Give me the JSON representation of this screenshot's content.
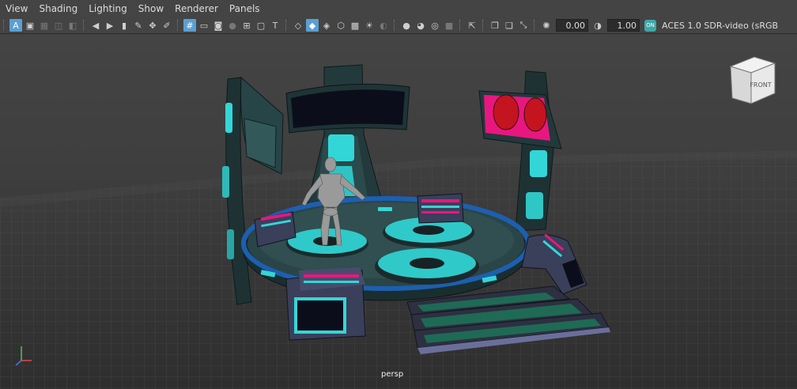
{
  "menu": [
    "View",
    "Shading",
    "Lighting",
    "Show",
    "Renderer",
    "Panels"
  ],
  "toolbar": {
    "exposure": "0.00",
    "gamma": "1.00",
    "cm_badge": "ON",
    "color_space": "ACES 1.0 SDR-video (sRGB"
  },
  "viewcube": {
    "face": "FRONT"
  },
  "camera": "persp",
  "icons": [
    "select-camera-icon",
    "lock-camera-icon",
    "bookmark-icon",
    "image-plane-icon",
    "grid-icon",
    "wireframe-icon",
    "smooth-shade-icon",
    "textured-icon",
    "lights-icon",
    "shadows-icon",
    "xray-icon",
    "isolate-icon",
    "exposure-icon",
    "color-management-icon"
  ],
  "colors": {
    "accent": "#5a9fd4",
    "teal": "#33d6d6",
    "magenta": "#e8177f",
    "panel": "#444444"
  }
}
